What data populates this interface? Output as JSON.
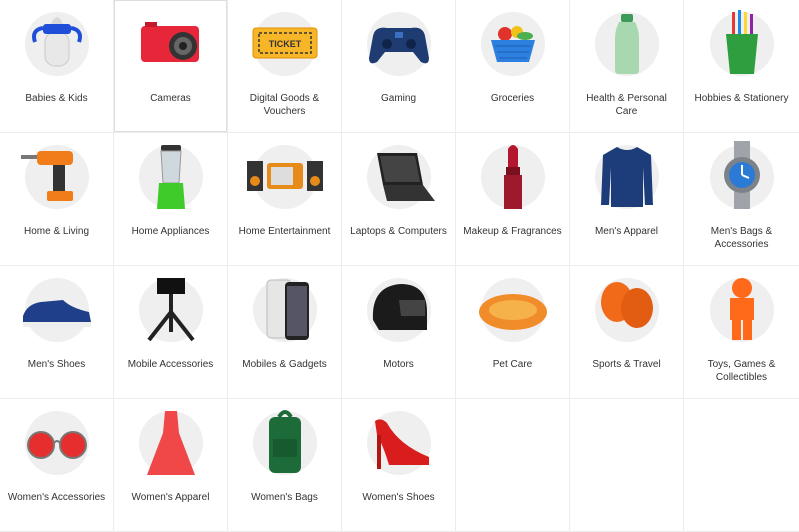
{
  "categories": [
    {
      "label": "Babies & Kids",
      "icon": "baby-bottle-icon"
    },
    {
      "label": "Cameras",
      "icon": "camera-icon"
    },
    {
      "label": "Digital Goods & Vouchers",
      "icon": "ticket-icon"
    },
    {
      "label": "Gaming",
      "icon": "gamepad-icon"
    },
    {
      "label": "Groceries",
      "icon": "grocery-basket-icon"
    },
    {
      "label": "Health & Personal Care",
      "icon": "lotion-bottle-icon"
    },
    {
      "label": "Hobbies & Stationery",
      "icon": "pencil-cup-icon"
    },
    {
      "label": "Home & Living",
      "icon": "power-drill-icon"
    },
    {
      "label": "Home Appliances",
      "icon": "blender-icon"
    },
    {
      "label": "Home Entertainment",
      "icon": "speakers-tv-icon"
    },
    {
      "label": "Laptops & Computers",
      "icon": "laptop-icon"
    },
    {
      "label": "Makeup & Fragrances",
      "icon": "lipstick-icon"
    },
    {
      "label": "Men's Apparel",
      "icon": "sweater-icon"
    },
    {
      "label": "Men's Bags & Accessories",
      "icon": "wristwatch-icon"
    },
    {
      "label": "Men's Shoes",
      "icon": "sneaker-icon"
    },
    {
      "label": "Mobile Accessories",
      "icon": "tripod-icon"
    },
    {
      "label": "Mobiles & Gadgets",
      "icon": "smartphone-icon"
    },
    {
      "label": "Motors",
      "icon": "helmet-icon"
    },
    {
      "label": "Pet Care",
      "icon": "pet-bed-icon"
    },
    {
      "label": "Sports & Travel",
      "icon": "boxing-gloves-icon"
    },
    {
      "label": "Toys, Games & Collectibles",
      "icon": "toy-figure-icon"
    },
    {
      "label": "Women's Accessories",
      "icon": "sunglasses-icon"
    },
    {
      "label": "Women's Apparel",
      "icon": "dress-icon"
    },
    {
      "label": "Women's Bags",
      "icon": "backpack-icon"
    },
    {
      "label": "Women's Shoes",
      "icon": "high-heel-icon"
    }
  ],
  "colors": {
    "border": "#ececec",
    "circle": "#efefef",
    "text": "#333333"
  }
}
